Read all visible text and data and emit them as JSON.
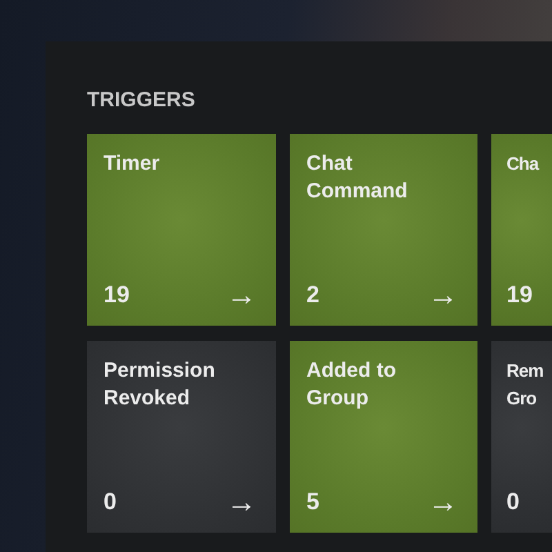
{
  "section": {
    "title": "TRIGGERS"
  },
  "tiles": [
    {
      "title": "Timer",
      "count": "19",
      "arrow": "→",
      "active": true
    },
    {
      "title": "Chat Command",
      "count": "2",
      "arrow": "→",
      "active": true
    },
    {
      "title": "Cha",
      "count": "19",
      "active": true
    },
    {
      "title": "Permission Revoked",
      "count": "0",
      "arrow": "→",
      "active": false
    },
    {
      "title": "Added to Group",
      "count": "5",
      "arrow": "→",
      "active": true
    },
    {
      "title": "Rem Gro",
      "count": "0",
      "active": false
    }
  ]
}
